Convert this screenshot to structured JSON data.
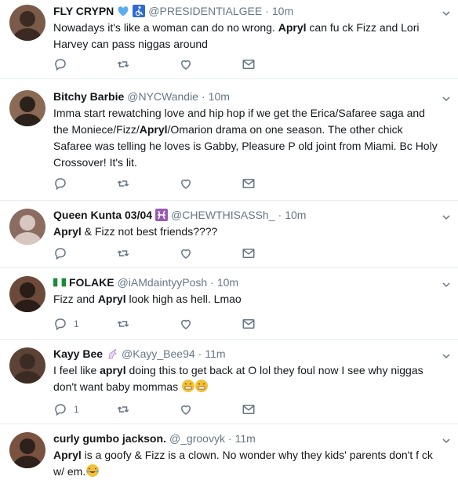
{
  "colors": {
    "secondary": "#657786",
    "text": "#14171a",
    "divider": "#e6ecf0"
  },
  "tweets": [
    {
      "name": "FLY CRYPN",
      "handle": "@PRESIDENTIALGEE",
      "dot": "·",
      "time": "10m",
      "parts": [
        {
          "t": "Nowadays it's like a woman can do no wrong. "
        },
        {
          "b": "Apryl"
        },
        {
          "t": " can fu  ck Fizz and Lori Harvey can pass niggas around"
        }
      ],
      "reply_count": "",
      "badges": [
        "blue-heart-emoji",
        "wheelchair-symbol-emoji"
      ]
    },
    {
      "name": "Bitchy Barbie",
      "handle": "@NYCWandie",
      "dot": "·",
      "time": "10m",
      "parts": [
        {
          "t": "Imma start rewatching love and hip hop if we get the Erica/Safaree saga and the Moniece/Fizz/"
        },
        {
          "b": "Apryl"
        },
        {
          "t": "/Omarion drama on one season. The other chick Safaree was telling he loves is Gabby, Pleasure P old joint from Miami. Bc Holy Crossover! It's lit."
        }
      ],
      "reply_count": ""
    },
    {
      "name": "Queen Kunta 03/04",
      "handle": "@CHEWTHISASSh_",
      "dot": "·",
      "time": "10m",
      "parts": [
        {
          "b": "Apryl"
        },
        {
          "t": " & Fizz not best friends????"
        }
      ],
      "reply_count": "",
      "badges": [
        "pisces-emoji"
      ]
    },
    {
      "name": "FOLAKE",
      "handle": "@iAMdaintyyPosh",
      "dot": "·",
      "time": "10m",
      "parts": [
        {
          "t": "Fizz and "
        },
        {
          "b": "Apryl"
        },
        {
          "t": " look high as hell. Lmao"
        }
      ],
      "reply_count": "1",
      "badges": [
        "nigeria-flag-emoji"
      ]
    },
    {
      "name": "Kayy Bee",
      "handle": "@Kayy_Bee94",
      "dot": "·",
      "time": "11m",
      "parts": [
        {
          "t": "I feel like "
        },
        {
          "b": "apryl"
        },
        {
          "t": " doing this to get back at O lol they foul now I see why niggas don't want baby mommas "
        }
      ],
      "reply_count": "1",
      "badges": [
        "unicorn-emoji"
      ],
      "trailing_emoji": [
        "grimace-emoji",
        "grimace-emoji"
      ]
    },
    {
      "name": "curly gumbo jackson.",
      "handle": "@_groovyk",
      "dot": "·",
      "time": "11m",
      "parts": [
        {
          "b": "Apryl"
        },
        {
          "t": " is a goofy & Fizz is a clown. No wonder why they kids' parents don't f  ck w/ em."
        }
      ],
      "reply_count": "",
      "trailing_emoji": [
        "laughing-crying-emoji"
      ]
    }
  ]
}
